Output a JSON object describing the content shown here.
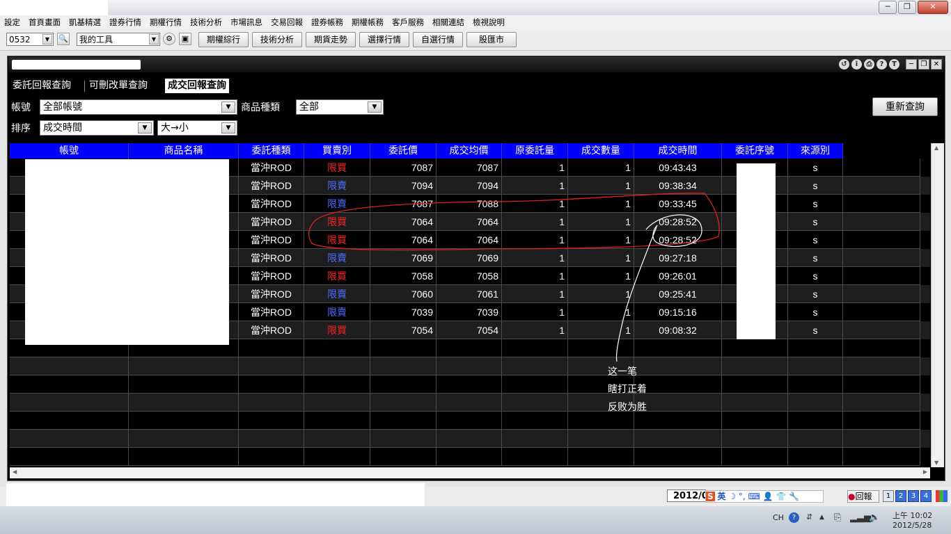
{
  "window": {
    "controls": {
      "minimize": "─",
      "restore": "❐",
      "close": "✕"
    }
  },
  "menu": [
    "設定",
    "首頁畫面",
    "凱基精選",
    "證券行情",
    "期權行情",
    "技術分析",
    "市場訊息",
    "交易回報",
    "證券帳務",
    "期權帳務",
    "客戶服務",
    "相關連結",
    "檢視說明"
  ],
  "toolbar": {
    "stock_code": "0532",
    "tools_combo": "我的工具",
    "buttons": [
      "期權綜行",
      "技術分析",
      "期貨走勢",
      "選擇行情",
      "自選行情",
      "股匯市"
    ]
  },
  "inner_controls": {
    "btn_t": "T"
  },
  "tabs": [
    "委託回報查詢",
    "可刪改單查詢",
    "成交回報查詢"
  ],
  "filters": {
    "account_label": "帳號",
    "account_value": "全部帳號",
    "product_label": "商品種類",
    "product_value": "全部",
    "sort_label": "排序",
    "sort_value": "成交時間",
    "order_value": "大→小",
    "requery_button": "重新查詢"
  },
  "table": {
    "columns": [
      "帳號",
      "商品名稱",
      "委託種類",
      "買賣別",
      "委託價",
      "成交均價",
      "原委託量",
      "成交數量",
      "成交時間",
      "委託序號",
      "來源別"
    ],
    "rows": [
      {
        "type": "當沖ROD",
        "side": "限買",
        "price": "7087",
        "avg": "7087",
        "orig": "1",
        "filled": "1",
        "time": "09:43:43",
        "src": "s"
      },
      {
        "type": "當沖ROD",
        "side": "限賣",
        "price": "7094",
        "avg": "7094",
        "orig": "1",
        "filled": "1",
        "time": "09:38:34",
        "src": "s"
      },
      {
        "type": "當沖ROD",
        "side": "限賣",
        "price": "7087",
        "avg": "7088",
        "orig": "1",
        "filled": "1",
        "time": "09:33:45",
        "src": "s"
      },
      {
        "type": "當沖ROD",
        "side": "限買",
        "price": "7064",
        "avg": "7064",
        "orig": "1",
        "filled": "1",
        "time": "09:28:52",
        "src": "s"
      },
      {
        "type": "當沖ROD",
        "side": "限買",
        "price": "7064",
        "avg": "7064",
        "orig": "1",
        "filled": "1",
        "time": "09:28:52",
        "src": "s"
      },
      {
        "type": "當沖ROD",
        "side": "限賣",
        "price": "7069",
        "avg": "7069",
        "orig": "1",
        "filled": "1",
        "time": "09:27:18",
        "src": "s"
      },
      {
        "type": "當沖ROD",
        "side": "限買",
        "price": "7058",
        "avg": "7058",
        "orig": "1",
        "filled": "1",
        "time": "09:26:01",
        "src": "s"
      },
      {
        "type": "當沖ROD",
        "side": "限賣",
        "price": "7060",
        "avg": "7061",
        "orig": "1",
        "filled": "1",
        "time": "09:25:41",
        "src": "s"
      },
      {
        "type": "當沖ROD",
        "side": "限賣",
        "price": "7039",
        "avg": "7039",
        "orig": "1",
        "filled": "1",
        "time": "09:15:16",
        "src": "s"
      },
      {
        "type": "當沖ROD",
        "side": "限買",
        "price": "7054",
        "avg": "7054",
        "orig": "1",
        "filled": "1",
        "time": "09:08:32",
        "src": "s"
      }
    ]
  },
  "annotation": [
    "这一笔",
    "瞎打正着",
    "反败为胜"
  ],
  "status": {
    "date_partial": "2012/0",
    "ime_label": "英",
    "report_label": "回報"
  },
  "taskbar": {
    "lang": "CH",
    "time": "上午 10:02",
    "date": "2012/5/28"
  },
  "colors": {
    "header_blue": "#0000ff",
    "buy_red": "#ff2020",
    "sell_blue": "#4a6cff",
    "annotation_red": "#e02020"
  }
}
